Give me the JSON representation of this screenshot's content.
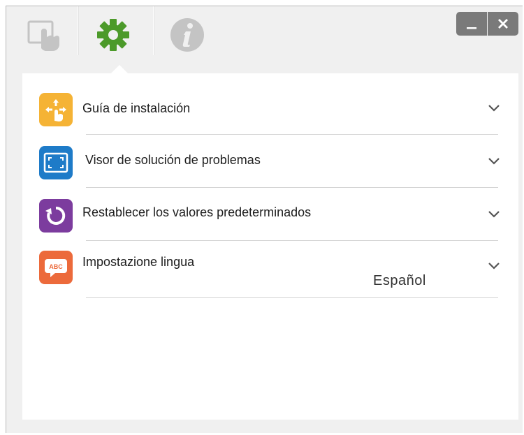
{
  "tabs": [
    {
      "name": "touch",
      "icon": "hand-touch-icon",
      "active": false
    },
    {
      "name": "settings",
      "icon": "gear-icon",
      "active": true
    },
    {
      "name": "info",
      "icon": "info-icon",
      "active": false
    }
  ],
  "window_controls": {
    "minimize": "_",
    "close": "✕"
  },
  "settings_items": [
    {
      "label": "Guía de instalación",
      "icon": "setup-guide-icon",
      "color": "#f5b335"
    },
    {
      "label": "Visor de solución de problemas",
      "icon": "troubleshoot-viewer-icon",
      "color": "#1e7bc8"
    },
    {
      "label": "Restablecer los valores predeterminados",
      "icon": "reset-defaults-icon",
      "color": "#7c3c9e"
    },
    {
      "label": "Impostazione lingua",
      "icon": "language-icon",
      "color": "#ec6a3b",
      "value": "Español"
    }
  ],
  "colors": {
    "accent_green": "#4c9a2a",
    "inactive_icon": "#c4c4c4",
    "window_bg": "#f0f0f0"
  }
}
